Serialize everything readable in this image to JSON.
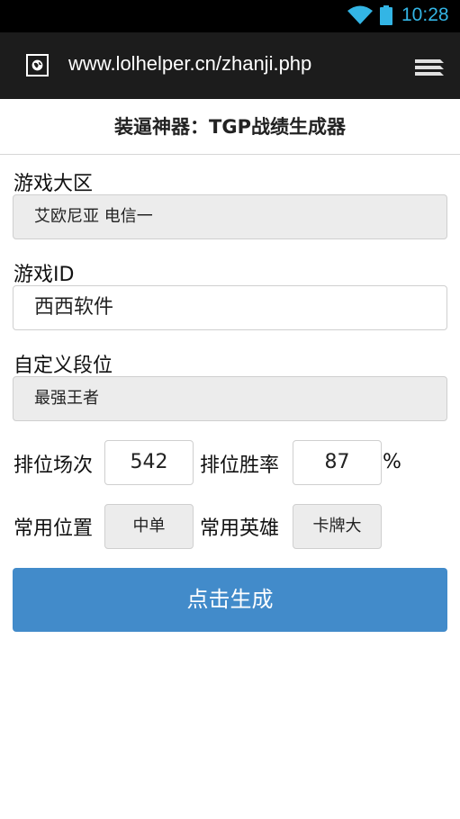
{
  "status_bar": {
    "time": "10:28",
    "accent_color": "#33b5e5",
    "icons": [
      "wifi-icon",
      "battery-icon"
    ]
  },
  "browser": {
    "url": "www.lolhelper.cn/zhanji.php",
    "icons": [
      "site-icon",
      "menu-icon"
    ]
  },
  "page": {
    "title": "装逼神器：TGP战绩生成器"
  },
  "form": {
    "region_label": "游戏大区",
    "region_value": "艾欧尼亚 电信一",
    "game_id_label": "游戏ID",
    "game_id_value": "西西软件",
    "rank_label": "自定义段位",
    "rank_value": "最强王者",
    "ranked_games_label": "排位场次",
    "ranked_games_value": "542",
    "win_rate_label": "排位胜率",
    "win_rate_value": "87",
    "win_rate_unit": "%",
    "position_label": "常用位置",
    "position_value": "中单",
    "hero_label": "常用英雄",
    "hero_value": "卡牌大",
    "submit_label": "点击生成",
    "button_color": "#428bca"
  }
}
